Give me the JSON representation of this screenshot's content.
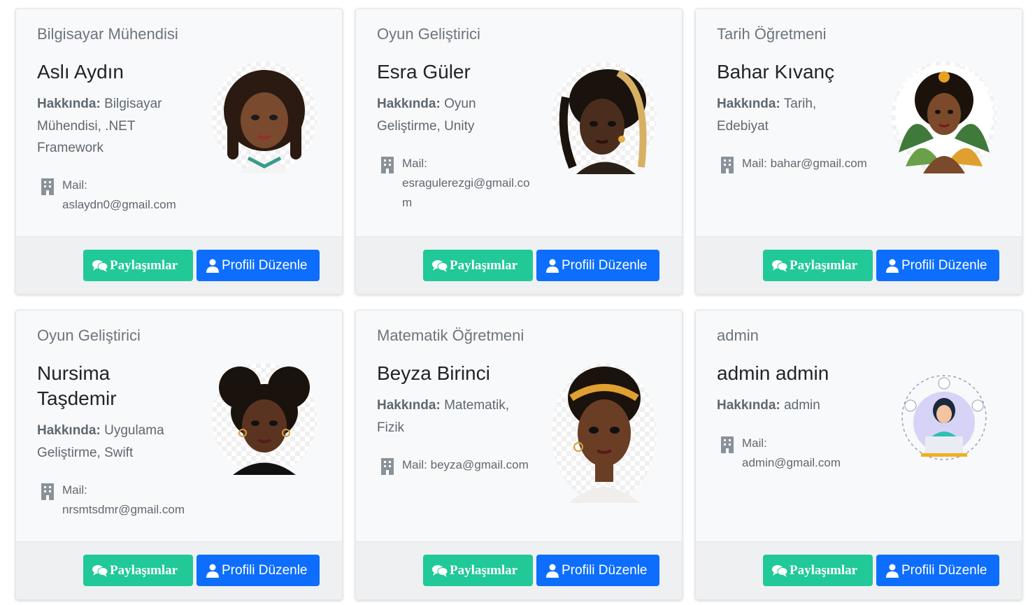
{
  "labels": {
    "about": "Hakkında:",
    "mail": "Mail:",
    "share_button": "Paylaşımlar",
    "edit_button": "Profili Düzenle"
  },
  "colors": {
    "share": "#20c997",
    "edit": "#0d6efd"
  },
  "profiles": [
    {
      "role": "Bilgisayar Mühendisi",
      "name": "Aslı Aydın",
      "about": "Bilgisayar Mühendisi, .NET Framework",
      "mail": "aslaydn0@gmail.com",
      "avatar_icon": "avatar-illustration"
    },
    {
      "role": "Oyun Geliştirici",
      "name": "Esra Güler",
      "about": "Oyun Geliştirme, Unity",
      "mail": "esragulerezgi@gmail.com",
      "avatar_icon": "avatar-illustration"
    },
    {
      "role": "Tarih Öğretmeni",
      "name": "Bahar Kıvanç",
      "about": "Tarih, Edebiyat",
      "mail": "bahar@gmail.com",
      "avatar_icon": "avatar-illustration"
    },
    {
      "role": "Oyun Geliştirici",
      "name": "Nursima Taşdemir",
      "about": "Uygulama Geliştirme, Swift",
      "mail": "nrsmtsdmr@gmail.com",
      "avatar_icon": "avatar-illustration"
    },
    {
      "role": "Matematik Öğretmeni",
      "name": "Beyza Birinci",
      "about": "Matematik, Fizik",
      "mail": "beyza@gmail.com",
      "avatar_icon": "avatar-illustration"
    },
    {
      "role": "admin",
      "name": "admin admin",
      "about": "admin",
      "mail": "admin@gmail.com",
      "avatar_icon": "support-agent-illustration"
    }
  ]
}
